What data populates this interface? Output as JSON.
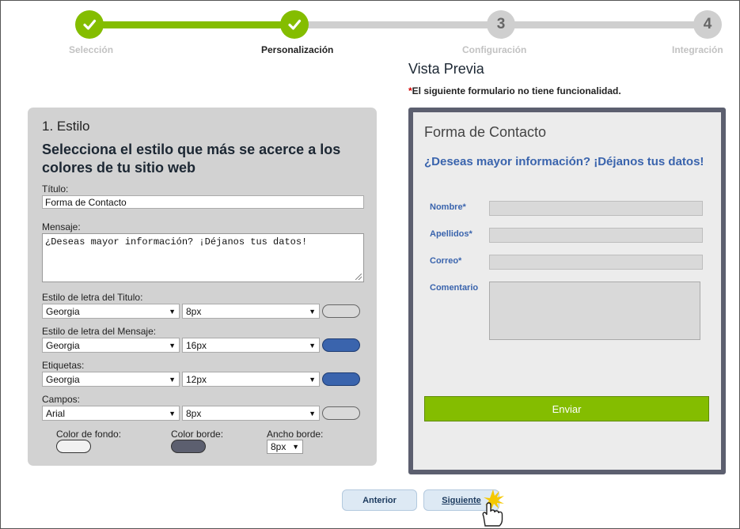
{
  "stepper": {
    "steps": [
      {
        "number": "",
        "label": "Selección",
        "state": "done"
      },
      {
        "number": "",
        "label": "Personalización",
        "state": "done"
      },
      {
        "number": "3",
        "label": "Configuración",
        "state": "todo"
      },
      {
        "number": "4",
        "label": "Integración",
        "state": "todo"
      }
    ]
  },
  "style_panel": {
    "title": "1. Estilo",
    "heading": "Selecciona el estilo que más se acerce a los colores de tu sitio web",
    "titulo_label": "Título:",
    "titulo_value": "Forma de Contacto",
    "mensaje_label": "Mensaje:",
    "mensaje_value": "¿Deseas mayor información? ¡Déjanos tus datos!",
    "rows": [
      {
        "label": "Estilo de letra del Titulo:",
        "font": "Georgia",
        "size": "8px",
        "color": "#d9d9d9"
      },
      {
        "label": "Estilo de letra del Mensaje:",
        "font": "Georgia",
        "size": "16px",
        "color": "#3a64ad"
      },
      {
        "label": "Etiquetas:",
        "font": "Georgia",
        "size": "12px",
        "color": "#3a64ad"
      },
      {
        "label": "Campos:",
        "font": "Arial",
        "size": "8px",
        "color": "#d9d9d9"
      }
    ],
    "color_fondo_label": "Color de fondo:",
    "color_fondo": "#f1f1f1",
    "color_borde_label": "Color borde:",
    "color_borde": "#5c5f6f",
    "ancho_borde_label": "Ancho borde:",
    "ancho_borde_value": "8px"
  },
  "preview": {
    "title": "Vista Previa",
    "note_asterisk": "*",
    "note": "El siguiente formulario no tiene funcionalidad.",
    "form_title": "Forma de Contacto",
    "form_message": "¿Deseas mayor información? ¡Déjanos tus datos!",
    "fields": [
      "Nombre*",
      "Apellidos*",
      "Correo*",
      "Comentario"
    ],
    "submit_label": "Enviar"
  },
  "nav": {
    "prev_label": "Anterior",
    "next_label": "Siguiente"
  },
  "colors": {
    "accent_green": "#84bd00",
    "inactive_gray": "#cfcfcf",
    "label_blue": "#3a64ad"
  }
}
